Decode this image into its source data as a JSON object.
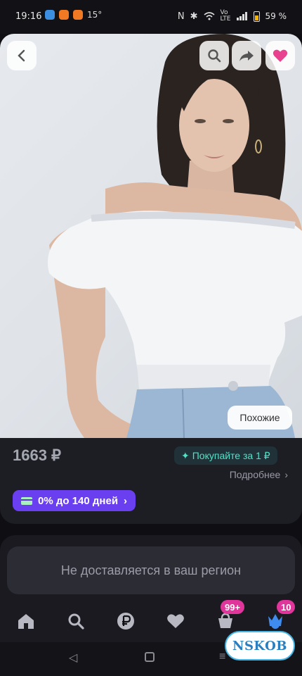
{
  "status_bar": {
    "time": "19:16",
    "temperature": "15°",
    "battery": "59 %",
    "icons": [
      "nfc-icon",
      "bluetooth-icon",
      "wifi-icon",
      "volte-icon",
      "signal-icon",
      "battery-icon"
    ]
  },
  "product": {
    "similar_label": "Похожие",
    "price": "1663 ₽",
    "promo_label": "Покупайте за 1 ₽",
    "more_label": "Подробнее",
    "installment_label": "0% до 140 дней"
  },
  "delivery": {
    "notice": "Не доставляется в ваш регион"
  },
  "tabbar": {
    "items": [
      {
        "icon": "home-icon"
      },
      {
        "icon": "search-icon"
      },
      {
        "icon": "ruble-icon"
      },
      {
        "icon": "heart-icon"
      },
      {
        "icon": "cart-icon",
        "badge": "99+"
      },
      {
        "icon": "profile-icon",
        "badge": "10"
      }
    ]
  },
  "watermark": "NSKOB",
  "colors": {
    "accent_purple": "#6a3ff0",
    "promo_teal": "#54e0c8",
    "badge_pink": "#e0359a",
    "favorite_pink": "#e8418f"
  }
}
